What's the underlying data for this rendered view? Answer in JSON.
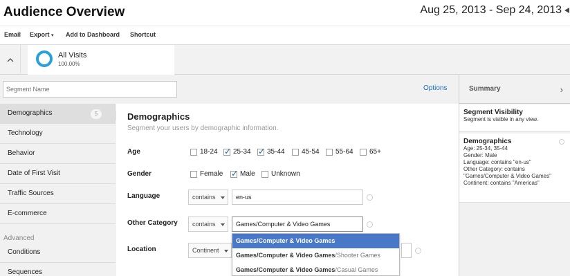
{
  "header": {
    "title": "Audience Overview",
    "date_range": "Aug 25, 2013 - Sep 24, 2013"
  },
  "toolbar": {
    "email": "Email",
    "export": "Export",
    "add_to_dashboard": "Add to Dashboard",
    "shortcut": "Shortcut"
  },
  "segment_strip": {
    "name": "All Visits",
    "percent": "100.00%",
    "ring_color": "#29a0d8"
  },
  "builder": {
    "segment_name_placeholder": "Segment Name",
    "options_label": "Options"
  },
  "sidebar": {
    "items": [
      {
        "label": "Demographics",
        "badge": "5"
      },
      {
        "label": "Technology"
      },
      {
        "label": "Behavior"
      },
      {
        "label": "Date of First Visit"
      },
      {
        "label": "Traffic Sources"
      },
      {
        "label": "E-commerce"
      }
    ],
    "advanced_label": "Advanced",
    "advanced_items": [
      {
        "label": "Conditions"
      },
      {
        "label": "Sequences"
      }
    ]
  },
  "demographics": {
    "title": "Demographics",
    "subtitle": "Segment your users by demographic information.",
    "age": {
      "label": "Age",
      "options": [
        {
          "label": "18-24",
          "checked": false
        },
        {
          "label": "25-34",
          "checked": true
        },
        {
          "label": "35-44",
          "checked": true
        },
        {
          "label": "45-54",
          "checked": false
        },
        {
          "label": "55-64",
          "checked": false
        },
        {
          "label": "65+",
          "checked": false
        }
      ]
    },
    "gender": {
      "label": "Gender",
      "options": [
        {
          "label": "Female",
          "checked": false
        },
        {
          "label": "Male",
          "checked": true
        },
        {
          "label": "Unknown",
          "checked": false
        }
      ]
    },
    "language": {
      "label": "Language",
      "operator": "contains",
      "value": "en-us"
    },
    "other_category": {
      "label": "Other Category",
      "operator": "contains",
      "value": "Games/Computer & Video Games"
    },
    "location": {
      "label": "Location",
      "dimension": "Continent"
    }
  },
  "autocomplete": {
    "items": [
      {
        "match": "Games/Computer & Video Games",
        "rest": ""
      },
      {
        "match": "Games/Computer & Video Games",
        "rest": "/Shooter Games"
      },
      {
        "match": "Games/Computer & Video Games",
        "rest": "/Casual Games"
      }
    ],
    "highlight_color": "#4a78c8"
  },
  "summary": {
    "title": "Summary",
    "visibility": {
      "heading": "Segment Visibility",
      "text": "Segment is visible in any view."
    },
    "demographics": {
      "heading": "Demographics",
      "lines": [
        "Age: 25-34, 35-44",
        "Gender: Male",
        "Language: contains \"en-us\"",
        "Other Category: contains \"Games/Computer & Video Games\"",
        "Continent: contains \"Americas\""
      ]
    }
  }
}
